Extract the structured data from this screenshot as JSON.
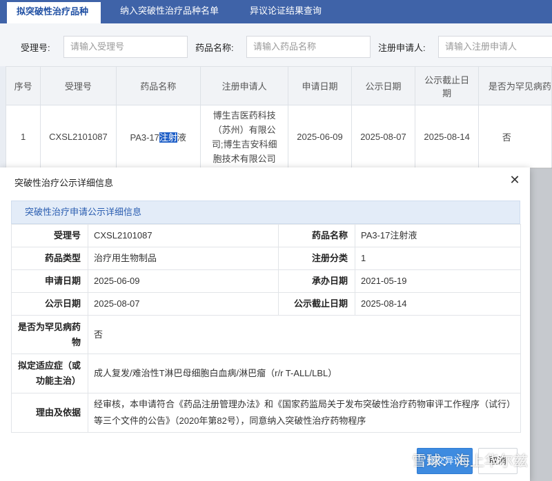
{
  "tabs": [
    {
      "label": "拟突破性治疗品种"
    },
    {
      "label": "纳入突破性治疗品种名单"
    },
    {
      "label": "异议论证结果查询"
    }
  ],
  "search": {
    "accept_no_label": "受理号:",
    "accept_no_placeholder": "请输入受理号",
    "drug_name_label": "药品名称:",
    "drug_name_placeholder": "请输入药品名称",
    "applicant_label": "注册申请人:",
    "applicant_placeholder": "请输入注册申请人"
  },
  "table": {
    "headers": [
      "序号",
      "受理号",
      "药品名称",
      "注册申请人",
      "申请日期",
      "公示日期",
      "公示截止日期",
      "是否为罕见病药"
    ],
    "row": {
      "index": "1",
      "accept_no": "CXSL2101087",
      "drug_name_prefix": "PA3-17",
      "drug_name_selected": "注射",
      "drug_name_suffix": "液",
      "applicant": "博生吉医药科技（苏州）有限公司;博生吉安科细胞技术有限公司",
      "apply_date": "2025-06-09",
      "publish_date": "2025-08-07",
      "deadline": "2025-08-14",
      "rare_disease": "否"
    }
  },
  "dialog": {
    "title": "突破性治疗公示详细信息",
    "section_title": "突破性治疗申请公示详细信息",
    "fields": {
      "accept_no_label": "受理号",
      "accept_no": "CXSL2101087",
      "drug_name_label": "药品名称",
      "drug_name": "PA3-17注射液",
      "drug_type_label": "药品类型",
      "drug_type": "治疗用生物制品",
      "reg_class_label": "注册分类",
      "reg_class": "1",
      "apply_date_label": "申请日期",
      "apply_date": "2025-06-09",
      "undertake_date_label": "承办日期",
      "undertake_date": "2021-05-19",
      "publish_date_label": "公示日期",
      "publish_date": "2025-08-07",
      "deadline_label": "公示截止日期",
      "deadline": "2025-08-14",
      "rare_label": "是否为罕见病药物",
      "rare": "否",
      "indication_label": "拟定适应症（或功能主治）",
      "indication": "成人复发/难治性T淋巴母细胞白血病/淋巴瘤（r/r T-ALL/LBL）",
      "reason_label": "理由及依据",
      "reason": "经审核，本申请符合《药品注册管理办法》和《国家药监局关于发布突破性治疗药物审评工作程序（试行）等三个文件的公告》（2020年第82号），同意纳入突破性治疗药物程序"
    },
    "submit_label": "提交异议",
    "cancel_label": "取消"
  },
  "watermark": "雪球：海上华尔兹",
  "colors": {
    "tab_bar": "#3f63a8",
    "section_head": "#e3ecf8",
    "primary_button": "#3e8be0"
  }
}
